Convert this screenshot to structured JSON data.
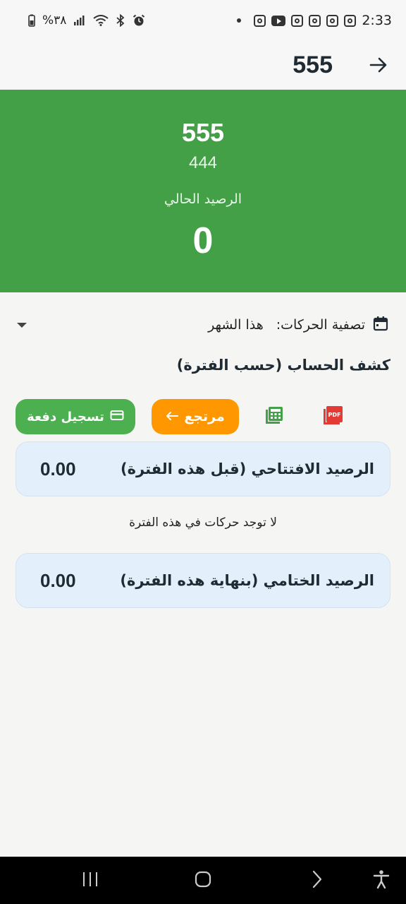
{
  "status_bar": {
    "time": "2:33",
    "battery_text": "%٣٨",
    "icons_right": [
      "instagram-icon",
      "instagram-icon",
      "instagram-icon",
      "instagram-icon",
      "youtube-icon",
      "instagram-icon"
    ],
    "icons_left": [
      "battery-icon",
      "signal-icon",
      "wifi-icon",
      "bluetooth-icon",
      "alarm-icon"
    ]
  },
  "app_bar": {
    "title": "555",
    "back_icon": "arrow-right-icon"
  },
  "hero": {
    "name": "555",
    "subtitle": "444",
    "balance_label": "الرصيد الحالي",
    "balance_value": "0",
    "color": "#43a047"
  },
  "filter": {
    "label": "تصفية الحركات:",
    "value": "هذا الشهر",
    "icon": "calendar-icon"
  },
  "statement": {
    "title": "كشف الحساب (حسب الفترة)"
  },
  "actions": {
    "pdf_icon": "pdf-icon",
    "calc_icon": "calculator-icon",
    "return_label": "مرتجع",
    "return_color": "#ff9800",
    "payment_label": "تسجيل دفعة",
    "payment_color": "#4caf50"
  },
  "opening_balance": {
    "label": "الرصيد الافتتاحي (قبل هذه الفترة)",
    "value": "0.00"
  },
  "empty_message": "لا توجد حركات في هذه الفترة",
  "closing_balance": {
    "label": "الرصيد الختامي (بنهاية هذه الفترة)",
    "value": "0.00"
  },
  "nav_bar": {
    "items": [
      "accessibility-icon",
      "back-icon",
      "home-icon",
      "recents-icon"
    ]
  }
}
